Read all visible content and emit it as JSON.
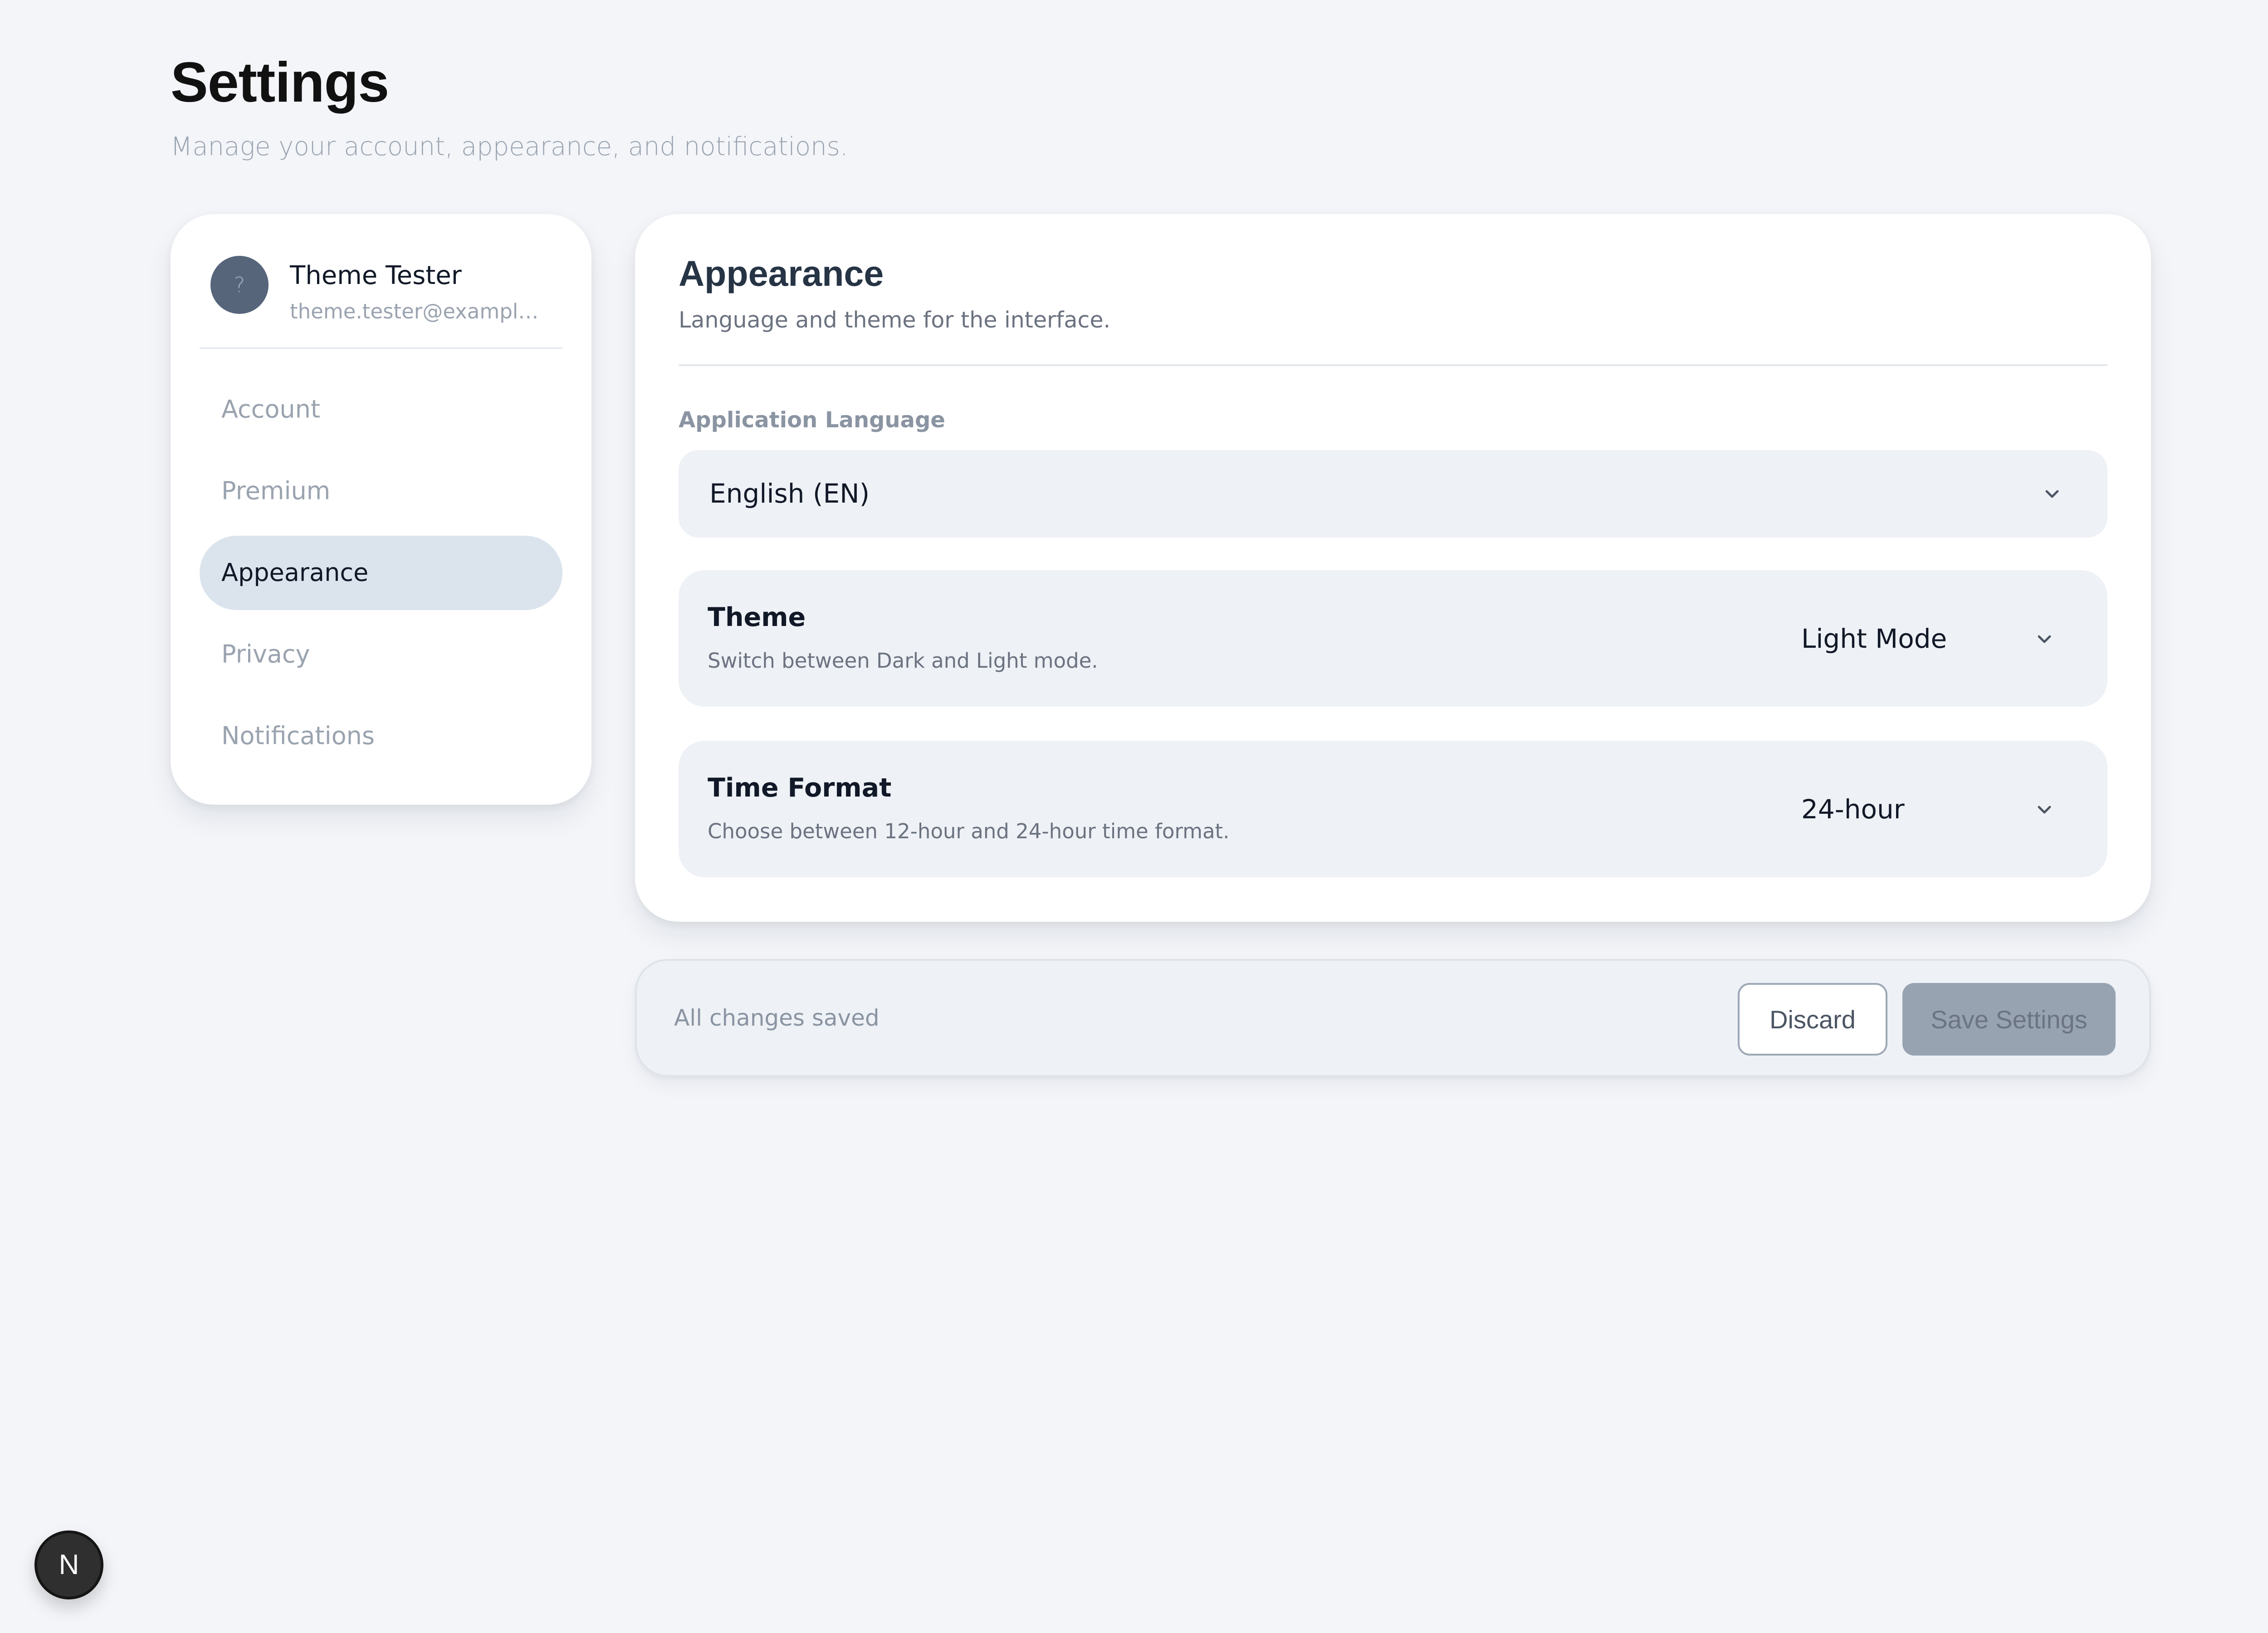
{
  "page": {
    "title": "Settings",
    "subtitle": "Manage your account, appearance, and notifications."
  },
  "sidebar": {
    "profile": {
      "avatar_icon": "?",
      "name": "Theme Tester",
      "email": "theme.tester@example.c..."
    },
    "items": [
      {
        "label": "Account",
        "active": false
      },
      {
        "label": "Premium",
        "active": false
      },
      {
        "label": "Appearance",
        "active": true
      },
      {
        "label": "Privacy",
        "active": false
      },
      {
        "label": "Notifications",
        "active": false
      }
    ]
  },
  "main": {
    "title": "Appearance",
    "subtitle": "Language and theme for the interface.",
    "language": {
      "label": "Application Language",
      "value": "English (EN)",
      "icon": "chevron-down-icon"
    },
    "theme": {
      "title": "Theme",
      "description": "Switch between Dark and Light mode.",
      "value": "Light Mode",
      "icon": "chevron-down-icon"
    },
    "time_format": {
      "title": "Time Format",
      "description": "Choose between 12-hour and 24-hour time format.",
      "value": "24-hour",
      "icon": "chevron-down-icon"
    }
  },
  "save_bar": {
    "status": "All changes saved",
    "discard_label": "Discard",
    "save_label": "Save Settings"
  },
  "badge": {
    "label": "N"
  },
  "colors": {
    "page_bg": "#f3f5f9",
    "card_bg": "#ffffff",
    "panel_bg": "#eef1f5",
    "active_nav_bg": "#dbe4ed",
    "avatar": "#56657a",
    "save_button_disabled": "#98a3b2"
  }
}
